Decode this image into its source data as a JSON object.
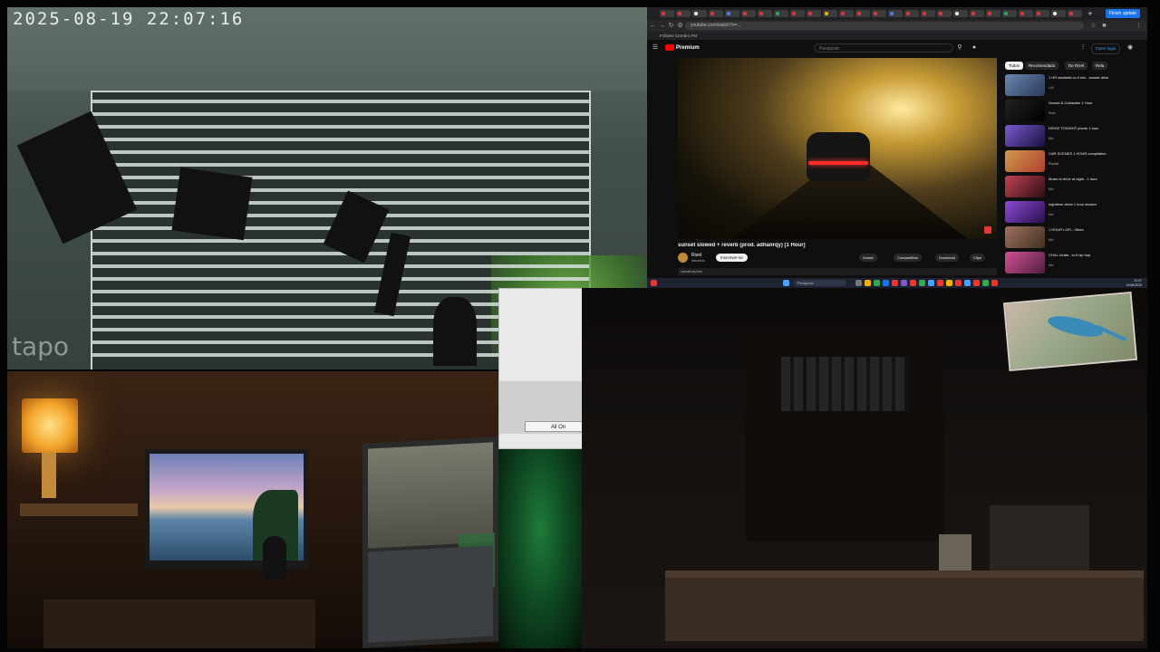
{
  "camera": {
    "timestamp": "2025-08-19  22:07:16",
    "watermark": "tapo"
  },
  "browser": {
    "chrome_button": "Finish update",
    "address": "youtube.com/watch?v=...",
    "bookmarks": "Fichiers   Cerebro FM",
    "header": {
      "logo": "Premium",
      "search_placeholder": "Pesquisar",
      "sign_in": "Fazer login"
    },
    "video": {
      "title": "sunset slowed + reverb (prod. adhanrqy) [1 Hour]",
      "channel": "Rizel",
      "subscribers": "inscritos",
      "subscribe": "Inscrever-se",
      "actions": [
        "Gostei",
        "Compartilhar",
        "Download",
        "Clipe"
      ],
      "views": "visualizações"
    },
    "chips": [
      "Todos",
      "Recomendado",
      "De Rizel",
      "Rela"
    ],
    "recommendations": [
      {
        "title": "1 HR aesthetic lo-fi mix - sunset drive",
        "sub": "Lofi"
      },
      {
        "title": "Sunset & Coldwater 1 Hour",
        "sub": "Rizel"
      },
      {
        "title": "DRIVE TONIGHT phonk 1 hour",
        "sub": "Mix"
      },
      {
        "title": "CAR SCENES 1 HOUR compilation",
        "sub": "Playlist"
      },
      {
        "title": "Music to drive at night - 1 hour",
        "sub": "Mix"
      },
      {
        "title": "nighttime vibes 1 hour slowed",
        "sub": "Mix"
      },
      {
        "title": "1 HOUR LOFI - Vibes",
        "sub": "Mix"
      },
      {
        "title": "CHILL beats - lo-fi hip hop",
        "sub": "Mix"
      }
    ],
    "taskbar": {
      "search": "Pesquisar",
      "clock_time": "22:07",
      "clock_date": "19/08/2025"
    }
  },
  "dialog": {
    "all_on": "All On"
  },
  "colors": {
    "youtube_red": "#ff0000",
    "accent_blue": "#1a73e8"
  }
}
